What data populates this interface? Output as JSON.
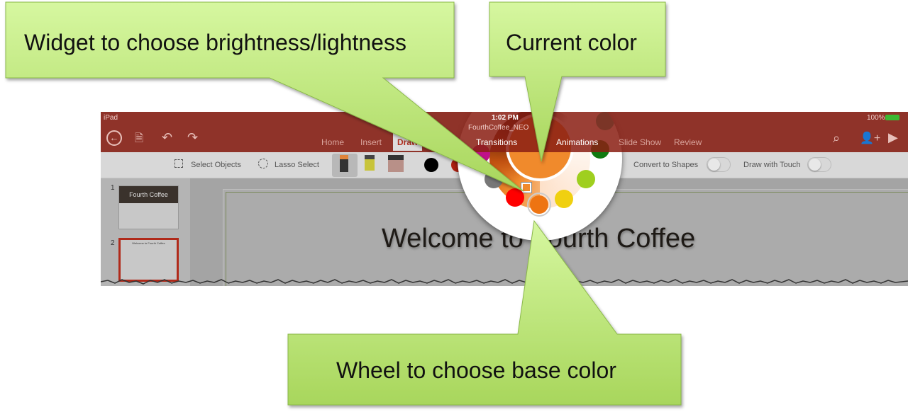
{
  "callouts": {
    "brightness": "Widget to choose brightness/lightness",
    "current_color": "Current color",
    "wheel": "Wheel to choose base color"
  },
  "status_bar": {
    "device": "iPad",
    "time": "1:02 PM",
    "filename": "FourthCoffee_NEO",
    "battery": "100%"
  },
  "tabs": [
    "Home",
    "Insert",
    "Draw",
    "Transitions",
    "Animations",
    "Slide Show",
    "Review"
  ],
  "toolbar": {
    "select_objects": "Select Objects",
    "lasso_select": "Lasso Select",
    "convert_to_shapes": "Convert to Shapes",
    "draw_with_touch": "Draw with Touch"
  },
  "slides": [
    {
      "number": "1",
      "title": "Fourth Coffee"
    },
    {
      "number": "2",
      "title": "Welcome to Fourth Coffee"
    }
  ],
  "slide_title": "Welcome to Fourth Coffee",
  "colors": {
    "ribbon": "#8a2014",
    "current_color": "#f08a2c",
    "swatches": [
      "#000000",
      "#1fb99a",
      "#107a10",
      "#9fcf1f",
      "#f0d010",
      "#ee7412",
      "#ff0000",
      "#777777",
      "#c0108a"
    ],
    "callout_fill": "#bde878"
  }
}
